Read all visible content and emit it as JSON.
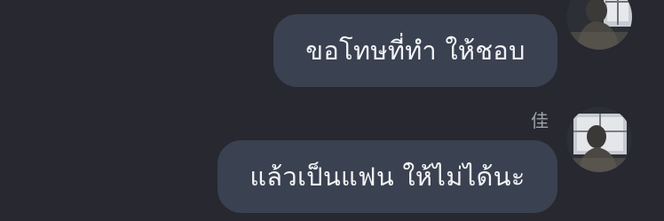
{
  "messages": [
    {
      "text": "ขอโทษที่ทำ ให้ชอบ",
      "sender": ""
    },
    {
      "text": "แล้วเป็นแฟน ให้ไม่ได้นะ",
      "sender": "佳"
    }
  ],
  "colors": {
    "background": "#272830",
    "bubble": "#3a4150",
    "text": "#f2f3f6",
    "sender_label": "#9ea2ad"
  }
}
